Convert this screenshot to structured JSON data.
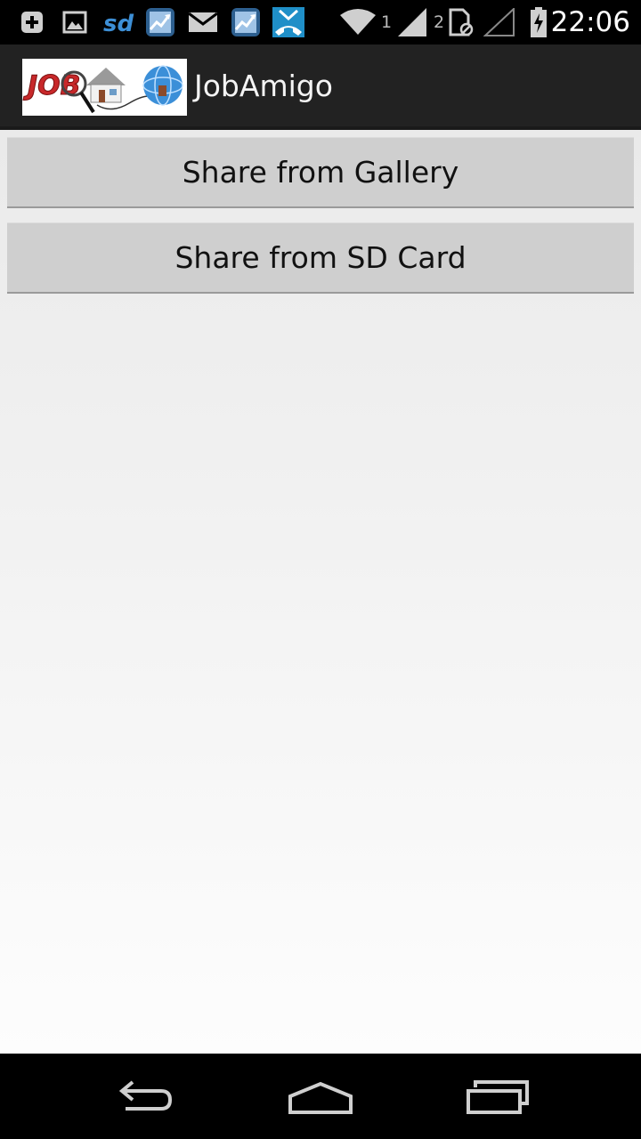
{
  "status_bar": {
    "time": "22:06",
    "sim1_label": "1",
    "sim2_label": "2",
    "icons": [
      "add-box-icon",
      "image-icon",
      "sd-icon",
      "stock-chart-icon",
      "mail-icon",
      "stock-chart-icon",
      "missed-call-icon",
      "wifi-icon",
      "signal-icon",
      "sim-card-icon",
      "no-signal-icon",
      "battery-charging-icon"
    ]
  },
  "action_bar": {
    "title": "JobAmigo",
    "logo_text": "JOB"
  },
  "buttons": {
    "gallery": "Share from Gallery",
    "sd_card": "Share from SD Card"
  },
  "nav_bar": {
    "icons": [
      "back-icon",
      "home-icon",
      "recent-apps-icon"
    ]
  }
}
